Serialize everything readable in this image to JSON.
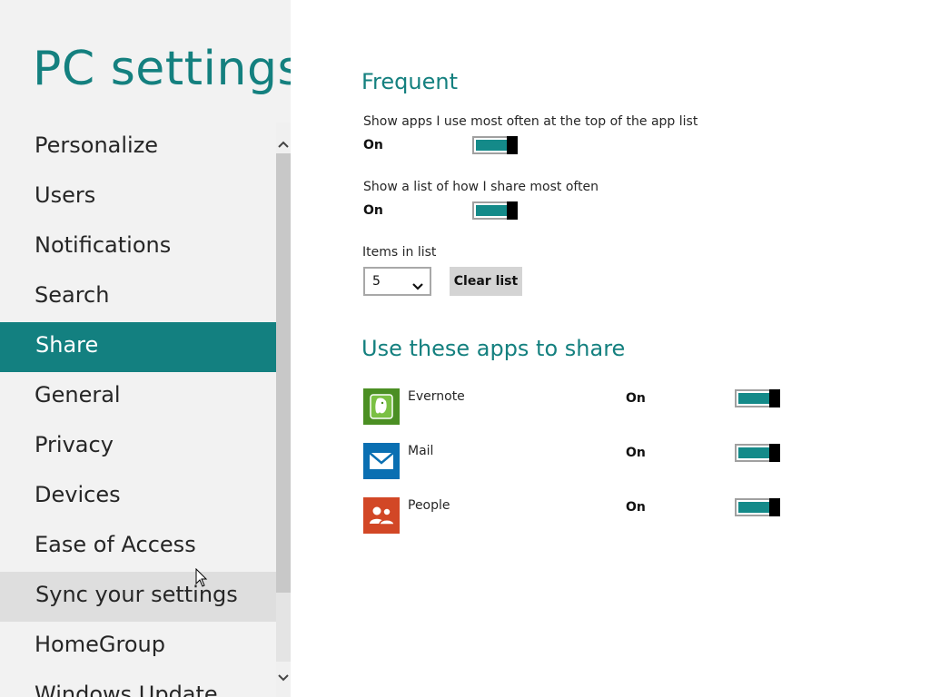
{
  "app": {
    "title": "PC settings"
  },
  "nav": {
    "items": [
      {
        "label": "Personalize"
      },
      {
        "label": "Users"
      },
      {
        "label": "Notifications"
      },
      {
        "label": "Search"
      },
      {
        "label": "Share"
      },
      {
        "label": "General"
      },
      {
        "label": "Privacy"
      },
      {
        "label": "Devices"
      },
      {
        "label": "Ease of Access"
      },
      {
        "label": "Sync your settings"
      },
      {
        "label": "HomeGroup"
      },
      {
        "label": "Windows Update"
      }
    ],
    "selected_index": 4,
    "hover_index": 9
  },
  "frequent": {
    "title": "Frequent",
    "settings": [
      {
        "label": "Show apps I use most often at the top of the app list",
        "state": "On",
        "toggle_on": true
      },
      {
        "label": "Show a list of how I share most often",
        "state": "On",
        "toggle_on": true
      }
    ],
    "items_in_list": {
      "label": "Items in list",
      "value": "5"
    },
    "clear_button": "Clear list"
  },
  "share_apps": {
    "title": "Use these apps to share",
    "apps": [
      {
        "name": "Evernote",
        "icon": "evernote-icon",
        "state": "On",
        "toggle_on": true
      },
      {
        "name": "Mail",
        "icon": "mail-icon",
        "state": "On",
        "toggle_on": true
      },
      {
        "name": "People",
        "icon": "people-icon",
        "state": "On",
        "toggle_on": true
      }
    ]
  },
  "colors": {
    "accent": "#14807f",
    "nav_selected_bg": "#138080",
    "left_pane_bg": "#f2f2f2",
    "toggle_fill": "#148a89",
    "evernote_tile": "#4b8f23",
    "mail_tile": "#0a6fb2",
    "people_tile": "#d24726"
  }
}
